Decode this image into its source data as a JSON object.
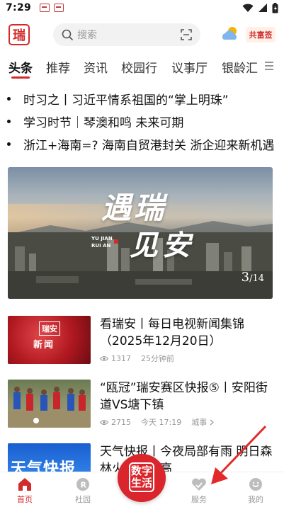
{
  "status": {
    "time": "7:29"
  },
  "header": {
    "logo_char": "瑞",
    "search_placeholder": "搜索",
    "brand": "共富签"
  },
  "tabs": [
    {
      "label": "头条",
      "active": true
    },
    {
      "label": "推荐"
    },
    {
      "label": "资讯"
    },
    {
      "label": "校园行"
    },
    {
      "label": "议事厅"
    },
    {
      "label": "银龄汇"
    }
  ],
  "headlines": [
    "时习之丨习近平情系祖国的“掌上明珠”",
    "学习时节｜琴澳和鸣  未来可期",
    "浙江+海南=? 海南自贸港封关  浙企迎来新机遇"
  ],
  "banner": {
    "calligraphy_top": "遇瑞",
    "calligraphy_bottom": "见安",
    "pinyin_1": "YU  JIAN",
    "pinyin_2": "RUI AN",
    "page_current": "3",
    "page_total": "/14"
  },
  "news": [
    {
      "thumb_label_1": "瑞安",
      "thumb_label_2": "新闻",
      "title": "看瑞安丨每日电视新闻集锦（2025年12月20日）",
      "views": "1317",
      "time": "25分钟前",
      "source": ""
    },
    {
      "title": "“瓯冠”瑞安赛区快报⑤丨安阳街道VS塘下镇",
      "views": "2715",
      "time": "今天 17:19",
      "source": "城事"
    },
    {
      "thumb_label_1": "天气快报",
      "title": "天气快报丨今夜局部有雨 明日森林火险等级高"
    }
  ],
  "bottom_nav": {
    "home": "首页",
    "community": "社园",
    "center": "数字生活",
    "service": "服务",
    "mine": "我的"
  },
  "colors": {
    "accent": "#d22b2b"
  }
}
